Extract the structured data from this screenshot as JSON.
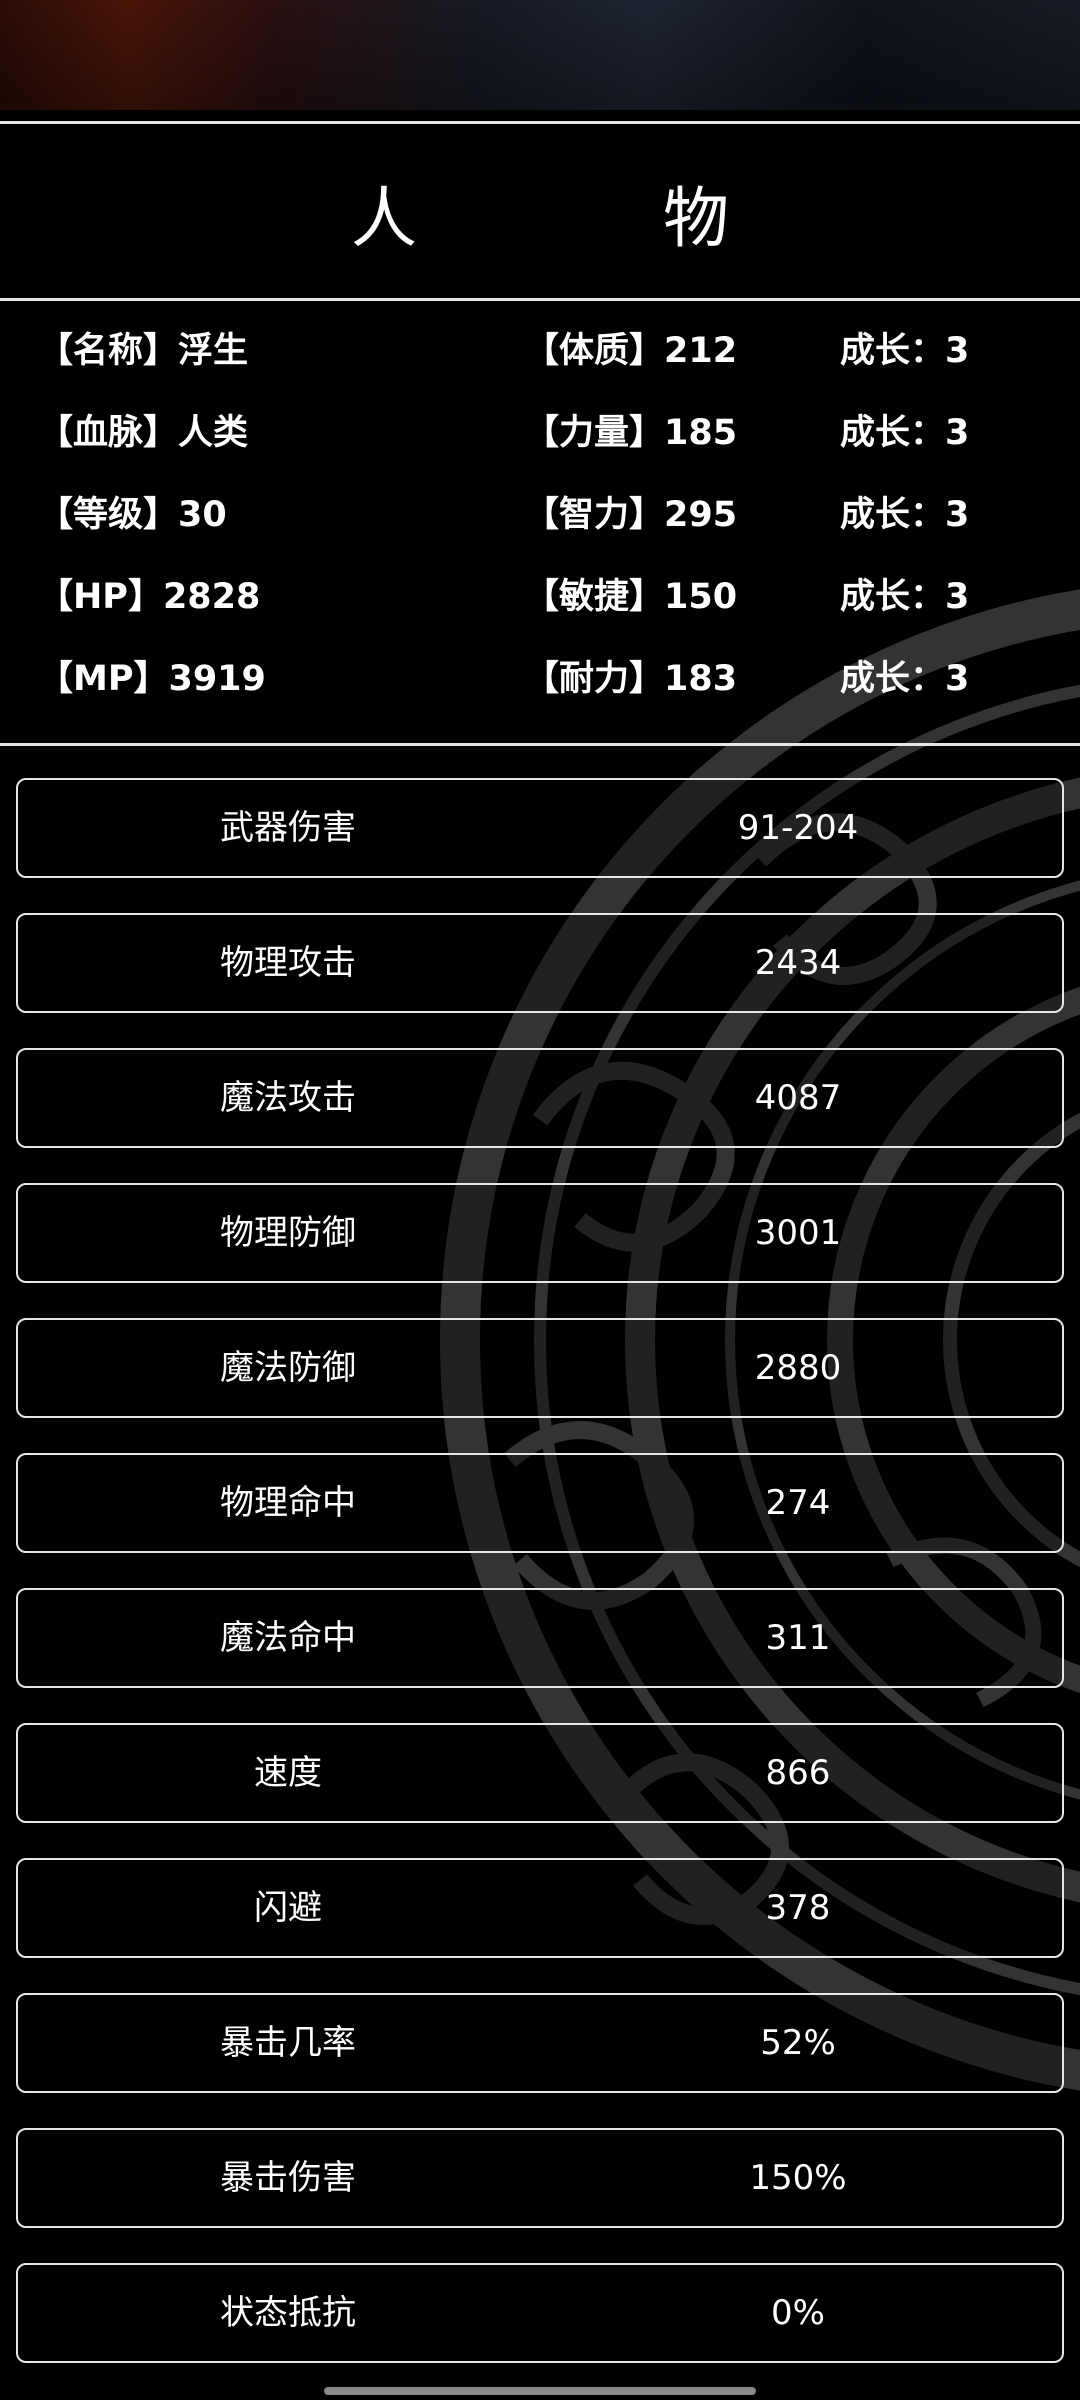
{
  "title": "人　物",
  "character": [
    {
      "left": "【名称】浮生",
      "mid": "【体质】212",
      "right": "成长：3"
    },
    {
      "left": "【血脉】人类",
      "mid": "【力量】185",
      "right": "成长：3"
    },
    {
      "left": "【等级】30",
      "mid": "【智力】295",
      "right": "成长：3"
    },
    {
      "left": "【HP】2828",
      "mid": "【敏捷】150",
      "right": "成长：3"
    },
    {
      "left": "【MP】3919",
      "mid": "【耐力】183",
      "right": "成长：3"
    }
  ],
  "stats": [
    {
      "name": "武器伤害",
      "value": "91-204"
    },
    {
      "name": "物理攻击",
      "value": "2434"
    },
    {
      "name": "魔法攻击",
      "value": "4087"
    },
    {
      "name": "物理防御",
      "value": "3001"
    },
    {
      "name": "魔法防御",
      "value": "2880"
    },
    {
      "name": "物理命中",
      "value": "274"
    },
    {
      "name": "魔法命中",
      "value": "311"
    },
    {
      "name": "速度",
      "value": "866"
    },
    {
      "name": "闪避",
      "value": "378"
    },
    {
      "name": "暴击几率",
      "value": "52%"
    },
    {
      "name": "暴击伤害",
      "value": "150%"
    },
    {
      "name": "状态抵抗",
      "value": "0%"
    }
  ],
  "icons": {
    "background_ornament": "cloud-pattern-ornament-icon"
  }
}
